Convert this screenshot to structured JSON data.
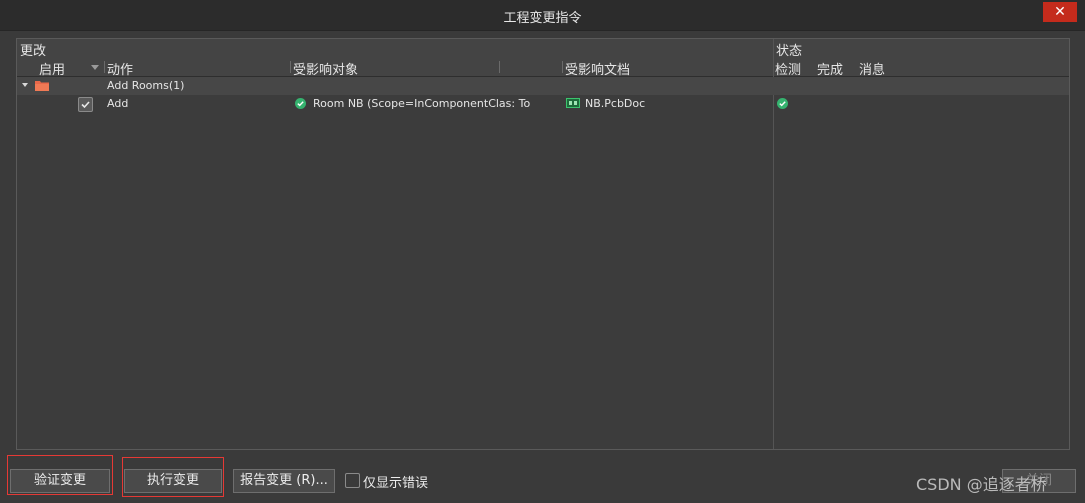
{
  "window": {
    "title": "工程变更指令",
    "close_glyph": "✕"
  },
  "grid": {
    "group_headers": {
      "changes": "更改",
      "status": "状态"
    },
    "columns": {
      "enable": "启用",
      "action": "动作",
      "affected_object": "受影响对象",
      "affected_document": "受影响文档",
      "check": "检测",
      "done": "完成",
      "message": "消息"
    },
    "group_row": {
      "action": "Add Rooms(1)"
    },
    "rows": [
      {
        "enabled": true,
        "action": "Add",
        "affected_object": "Room NB (Scope=InComponentClas: To",
        "affected_document": "NB.PcbDoc",
        "check_status": "ok"
      }
    ]
  },
  "footer": {
    "validate_button": "验证变更",
    "execute_button": "执行变更",
    "report_button": "报告变更 (R)...",
    "errors_only_label": "仅显示错误",
    "close_button_partial": "关闭",
    "watermark": "CSDN @追逐者桥"
  },
  "colors": {
    "close_bg": "#c42b1c",
    "ok_green": "#35b36f",
    "highlight_red": "#e53935",
    "folder": "#e8684a"
  }
}
